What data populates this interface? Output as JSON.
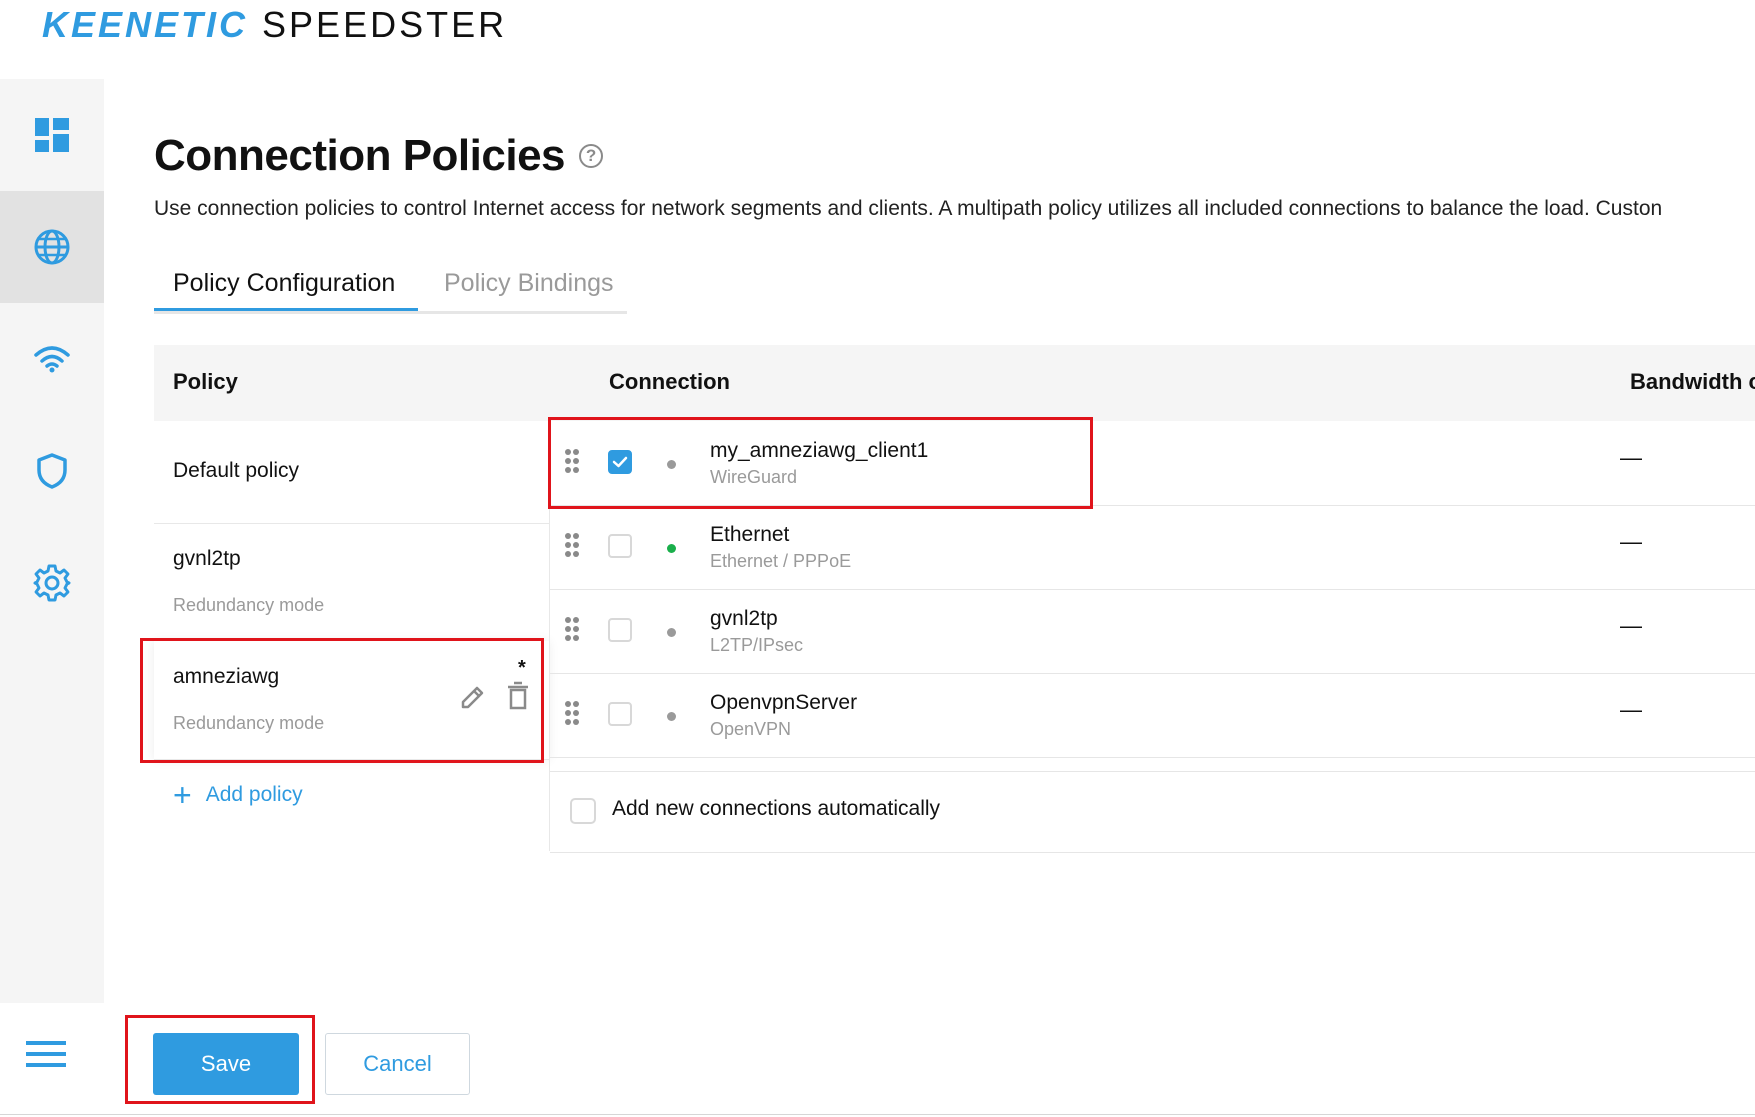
{
  "header": {
    "brand": "KEENETIC",
    "product": "SPEEDSTER"
  },
  "sidebar": {
    "items": [
      {
        "icon": "dashboard-icon",
        "active": false
      },
      {
        "icon": "globe-icon",
        "active": true
      },
      {
        "icon": "wifi-icon",
        "active": false
      },
      {
        "icon": "shield-icon",
        "active": false
      },
      {
        "icon": "gear-icon",
        "active": false
      }
    ]
  },
  "page": {
    "title": "Connection Policies",
    "help_icon": "?",
    "description": "Use connection policies to control Internet access for network segments and clients. A multipath policy utilizes all included connections to balance the load. Custon"
  },
  "tabs": [
    {
      "label": "Policy Configuration",
      "active": true
    },
    {
      "label": "Policy Bindings",
      "active": false
    }
  ],
  "table": {
    "headers": {
      "policy": "Policy",
      "connection": "Connection",
      "bandwidth": "Bandwidth c"
    },
    "policies": [
      {
        "name": "Default policy",
        "mode": ""
      },
      {
        "name": "gvnl2tp",
        "mode": "Redundancy mode"
      },
      {
        "name": "amneziawg",
        "mode": "Redundancy mode",
        "modified": "*"
      }
    ],
    "add_policy_label": "Add policy",
    "connections": [
      {
        "name": "my_amneziawg_client1",
        "type": "WireGuard",
        "checked": true,
        "status_color": "#9a9a9a",
        "bandwidth": "—"
      },
      {
        "name": "Ethernet",
        "type": "Ethernet / PPPoE",
        "checked": false,
        "status_color": "#1aaf4b",
        "bandwidth": "—"
      },
      {
        "name": "gvnl2tp",
        "type": "L2TP/IPsec",
        "checked": false,
        "status_color": "#9a9a9a",
        "bandwidth": "—"
      },
      {
        "name": "OpenvpnServer",
        "type": "OpenVPN",
        "checked": false,
        "status_color": "#9a9a9a",
        "bandwidth": "—"
      }
    ],
    "auto_add_label": "Add new connections automatically"
  },
  "footer": {
    "save_label": "Save",
    "cancel_label": "Cancel"
  },
  "colors": {
    "accent": "#2f9be0",
    "highlight": "#e0141b",
    "online": "#1aaf4b",
    "offline": "#9a9a9a"
  }
}
